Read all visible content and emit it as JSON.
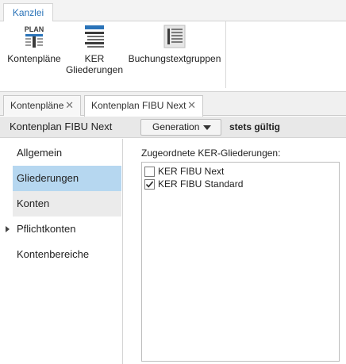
{
  "ribbon": {
    "tab_label": "Kanzlei",
    "buttons": [
      {
        "label": "Kontenpläne",
        "icon": "plan-icon",
        "icon_text": "PLAN"
      },
      {
        "label_line1": "KER",
        "label_line2": "Gliederungen",
        "icon": "ker-list-icon"
      },
      {
        "label": "Buchungstextgruppen",
        "icon": "text-groups-icon"
      }
    ]
  },
  "doc_tabs": [
    {
      "label": "Kontenpläne",
      "close": "✕"
    },
    {
      "label": "Kontenplan FIBU Next",
      "close": "✕"
    }
  ],
  "header": {
    "title": "Kontenplan FIBU Next",
    "generation_label": "Generation",
    "validity": "stets gültig"
  },
  "nav": {
    "items": [
      {
        "label": "Allgemein"
      },
      {
        "label": "Gliederungen"
      },
      {
        "label": "Konten"
      },
      {
        "label": "Pflichtkonten"
      },
      {
        "label": "Kontenbereiche"
      }
    ]
  },
  "main": {
    "list_label": "Zugeordnete KER-Gliederungen:",
    "items": [
      {
        "label": "KER FIBU Next",
        "checked": false
      },
      {
        "label": "KER FIBU Standard",
        "checked": true
      }
    ]
  },
  "colors": {
    "accent": "#2a73b8",
    "selected_nav": "#b6d7f0",
    "icon_blue": "#2a73b8",
    "icon_dark": "#3c3c3c"
  }
}
